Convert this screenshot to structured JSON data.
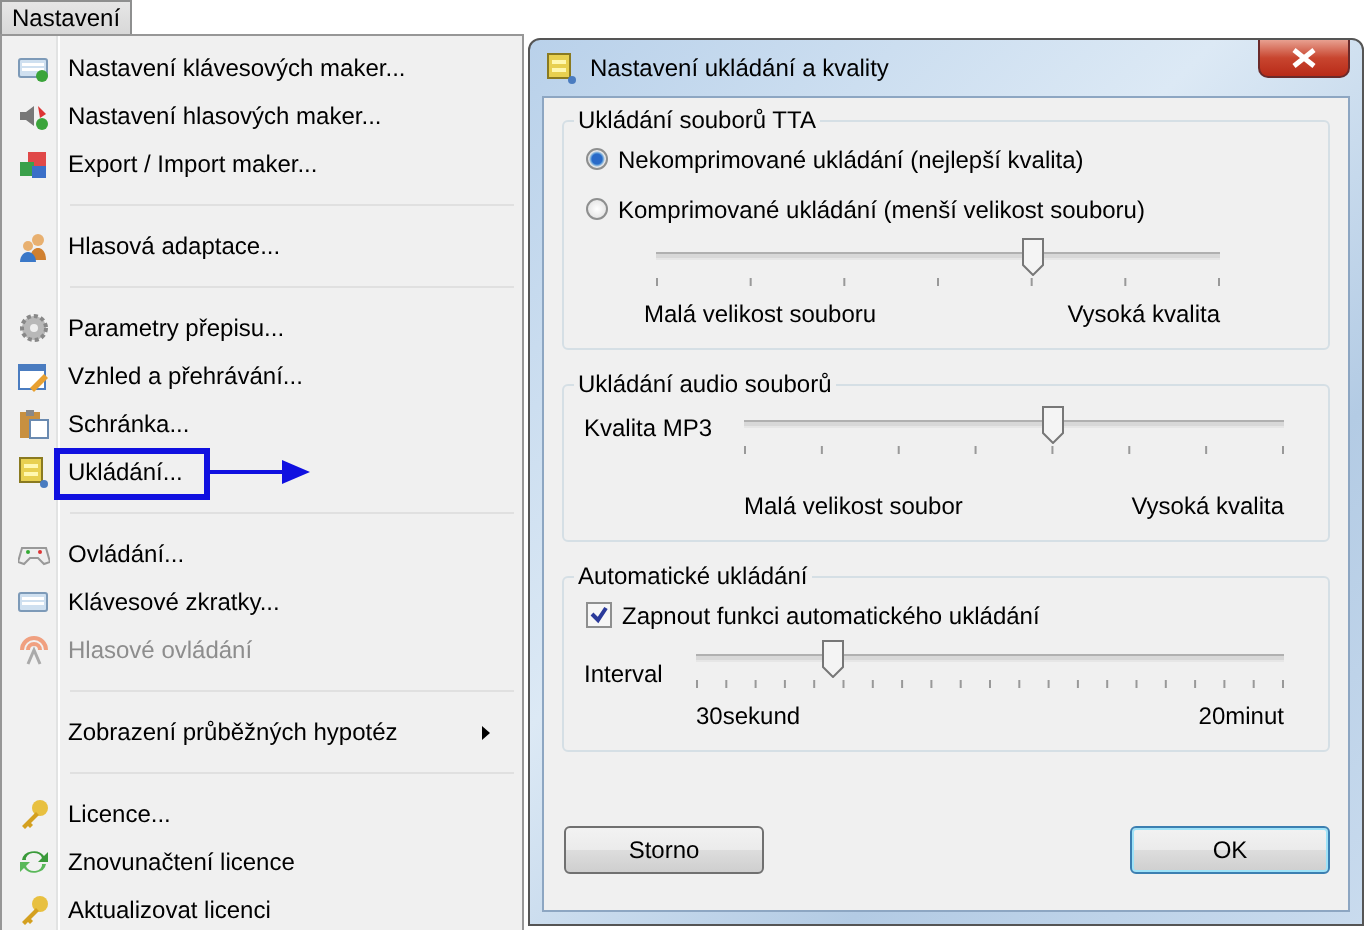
{
  "menu_button": {
    "label": "Nastavení",
    "selected": true
  },
  "menu": {
    "items": [
      {
        "kind": "item",
        "label": "Nastavení klávesových maker...",
        "disabled": false,
        "submenu": false,
        "highlighted": false
      },
      {
        "kind": "item",
        "label": "Nastavení hlasových maker...",
        "disabled": false,
        "submenu": false,
        "highlighted": false
      },
      {
        "kind": "item",
        "label": "Export / Import maker...",
        "disabled": false,
        "submenu": false,
        "highlighted": false
      },
      {
        "kind": "separator"
      },
      {
        "kind": "item",
        "label": "Hlasová adaptace...",
        "disabled": false,
        "submenu": false,
        "highlighted": false
      },
      {
        "kind": "separator"
      },
      {
        "kind": "item",
        "label": "Parametry přepisu...",
        "disabled": false,
        "submenu": false,
        "highlighted": false
      },
      {
        "kind": "item",
        "label": "Vzhled a přehrávání...",
        "disabled": false,
        "submenu": false,
        "highlighted": false
      },
      {
        "kind": "item",
        "label": "Schránka...",
        "disabled": false,
        "submenu": false,
        "highlighted": false
      },
      {
        "kind": "item",
        "label": "Ukládání...",
        "disabled": false,
        "submenu": false,
        "highlighted": true
      },
      {
        "kind": "separator"
      },
      {
        "kind": "item",
        "label": "Ovládání...",
        "disabled": false,
        "submenu": false,
        "highlighted": false
      },
      {
        "kind": "item",
        "label": "Klávesové zkratky...",
        "disabled": false,
        "submenu": false,
        "highlighted": false
      },
      {
        "kind": "item",
        "label": "Hlasové ovládání",
        "disabled": true,
        "submenu": false,
        "highlighted": false
      },
      {
        "kind": "separator"
      },
      {
        "kind": "item",
        "label": "Zobrazení průběžných hypotéz",
        "disabled": false,
        "submenu": true,
        "highlighted": false
      },
      {
        "kind": "separator"
      },
      {
        "kind": "item",
        "label": "Licence...",
        "disabled": false,
        "submenu": false,
        "highlighted": false
      },
      {
        "kind": "item",
        "label": "Znovunačtení licence",
        "disabled": false,
        "submenu": false,
        "highlighted": false
      },
      {
        "kind": "item",
        "label": "Aktualizovat licenci",
        "disabled": false,
        "submenu": false,
        "highlighted": false
      }
    ]
  },
  "dialog": {
    "title": "Nastavení ukládání a kvality",
    "groups": [
      {
        "kind": "radio",
        "title": "Ukládání souborů TTA",
        "options": [
          {
            "label": "Nekomprimované ukládání (nejlepší kvalita)",
            "selected": true
          },
          {
            "label": "Komprimované ukládání (menší velikost souboru)",
            "selected": false
          }
        ],
        "slider": {
          "level": 0.667,
          "min_label": "Malá velikost souboru",
          "max_label": "Vysoká kvalita"
        }
      },
      {
        "kind": "slider",
        "title": "Ukládání audio souborů",
        "slider": {
          "label": "Kvalita MP3",
          "level": 0.571,
          "min_label": "Malá velikost soubor",
          "max_label": "Vysoká kvalita"
        }
      },
      {
        "kind": "checkbox",
        "title": "Automatické ukládání",
        "checkbox": {
          "label": "Zapnout funkci automatického ukládání",
          "checked": true
        },
        "slider": {
          "label": "Interval",
          "level": 0.23,
          "min_label": "30sekund",
          "max_label": "20minut"
        }
      }
    ],
    "buttons": [
      {
        "label": "Storno",
        "default": false
      },
      {
        "label": "OK",
        "default": true
      }
    ]
  }
}
